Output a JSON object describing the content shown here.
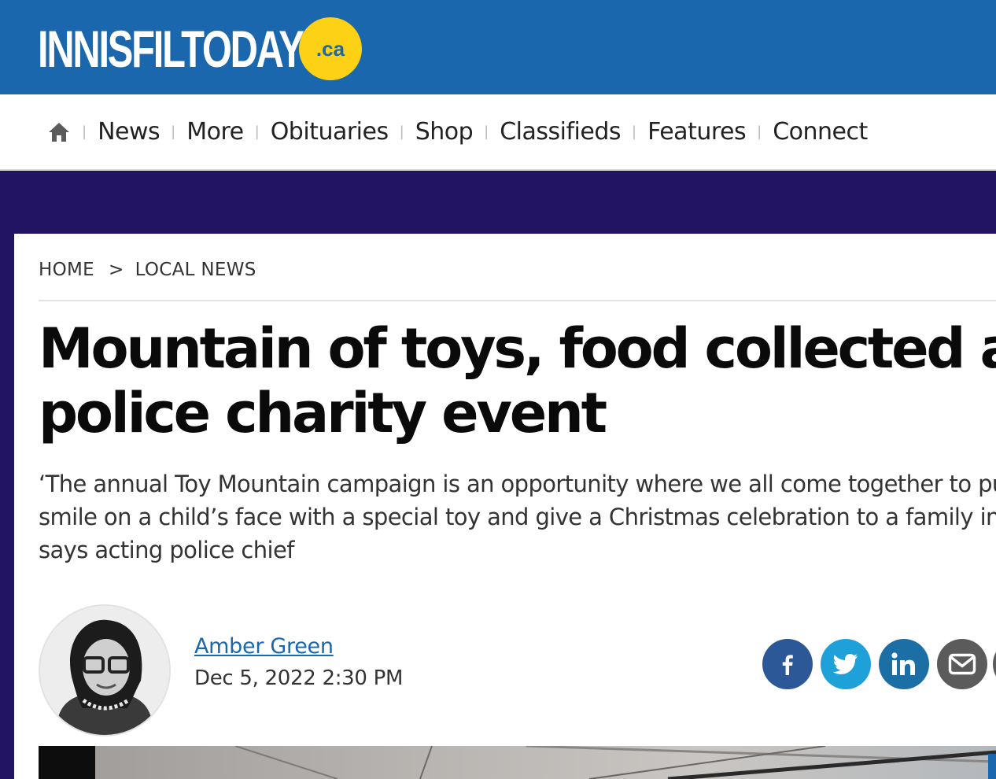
{
  "header": {
    "logo_text": "INNISFILTODAY",
    "logo_suffix": ".ca",
    "colors": {
      "brand_blue": "#1a67ad",
      "brand_yellow": "#fcd116",
      "band_purple": "#221462"
    }
  },
  "nav": {
    "home_icon": "home-icon",
    "items": [
      {
        "label": "News"
      },
      {
        "label": "More"
      },
      {
        "label": "Obituaries"
      },
      {
        "label": "Shop"
      },
      {
        "label": "Classifieds"
      },
      {
        "label": "Features"
      },
      {
        "label": "Connect"
      }
    ]
  },
  "breadcrumb": {
    "home": "HOME",
    "separator": ">",
    "section": "LOCAL NEWS"
  },
  "article": {
    "headline_line1": "Mountain of toys, food collected at",
    "headline_line2": "police charity event",
    "dek_line1": "‘The annual Toy Mountain campaign is an opportunity where we all come together to pu",
    "dek_line2": "smile on a child’s face with a special toy and give a Christmas celebration to a family in n",
    "dek_line3": "says acting police chief",
    "author": "Amber Green",
    "date": "Dec 5, 2022 2:30 PM"
  },
  "share": {
    "icons": [
      "facebook-icon",
      "twitter-icon",
      "linkedin-icon",
      "email-icon"
    ],
    "colors": {
      "facebook": "#2d5897",
      "twitter": "#1ea1d8",
      "linkedin": "#1c6fa5",
      "email": "#5b5b5b"
    }
  }
}
